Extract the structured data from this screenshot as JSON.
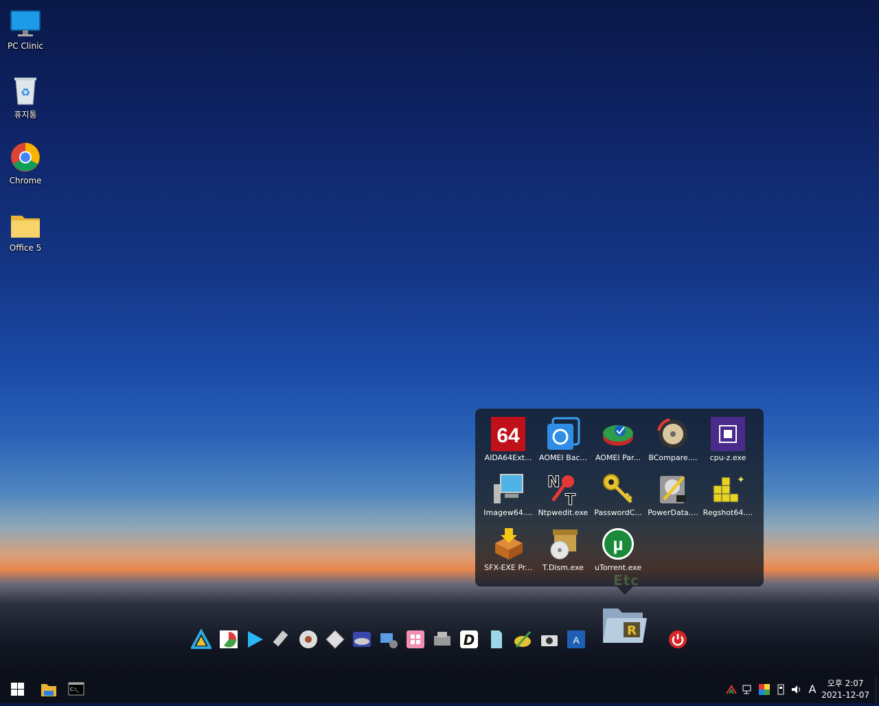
{
  "desktop": {
    "icons": [
      {
        "label": "PC Clinic",
        "icon": "monitor-icon"
      },
      {
        "label": "휴지통",
        "icon": "recycle-bin-icon"
      },
      {
        "label": "Chrome",
        "icon": "chrome-icon"
      },
      {
        "label": "Office 5",
        "icon": "folder-icon"
      }
    ]
  },
  "popup": {
    "title": "Etc",
    "items": [
      {
        "label": "AIDA64Ext...",
        "icon": "aida64-icon"
      },
      {
        "label": "AOMEI Bac...",
        "icon": "aomei-backupper-icon"
      },
      {
        "label": "AOMEI Par...",
        "icon": "aomei-partition-icon"
      },
      {
        "label": "BCompare....",
        "icon": "bcompare-icon"
      },
      {
        "label": "cpu-z.exe",
        "icon": "cpu-z-icon"
      },
      {
        "label": "Imagew64....",
        "icon": "imagew-icon"
      },
      {
        "label": "Ntpwedit.exe",
        "icon": "ntpwedit-icon"
      },
      {
        "label": "PasswordC...",
        "icon": "password-key-icon"
      },
      {
        "label": "PowerData....",
        "icon": "powerdata-icon"
      },
      {
        "label": "Regshot64....",
        "icon": "regshot-icon"
      },
      {
        "label": "SFX-EXE Pr...",
        "icon": "sfx-exe-icon"
      },
      {
        "label": "T.Dism.exe",
        "icon": "tdism-icon"
      },
      {
        "label": "uTorrent.exe",
        "icon": "utorrent-icon"
      }
    ]
  },
  "dock": {
    "icons": [
      "triangle-app-icon",
      "partition-pie-icon",
      "play-icon",
      "usb-drive-icon",
      "disc-icon",
      "diamond-app-icon",
      "disk-scan-icon",
      "network-drive-icon",
      "windows-tiles-icon",
      "hdd-tool-icon",
      "d-app-icon",
      "file-icon",
      "pen-app-icon",
      "camera-icon",
      "a-app-icon"
    ],
    "folder_icon": "etc-folder-icon",
    "power_icon": "power-icon"
  },
  "taskbar": {
    "start_icon": "windows-start-icon",
    "pinned": [
      "file-explorer-icon",
      "command-prompt-icon"
    ],
    "tray": {
      "icons": [
        "network-share-icon",
        "network-icon",
        "color-app-icon",
        "usb-eject-icon",
        "volume-icon"
      ],
      "ime": "A",
      "time": "오후 2:07",
      "date": "2021-12-07"
    }
  }
}
